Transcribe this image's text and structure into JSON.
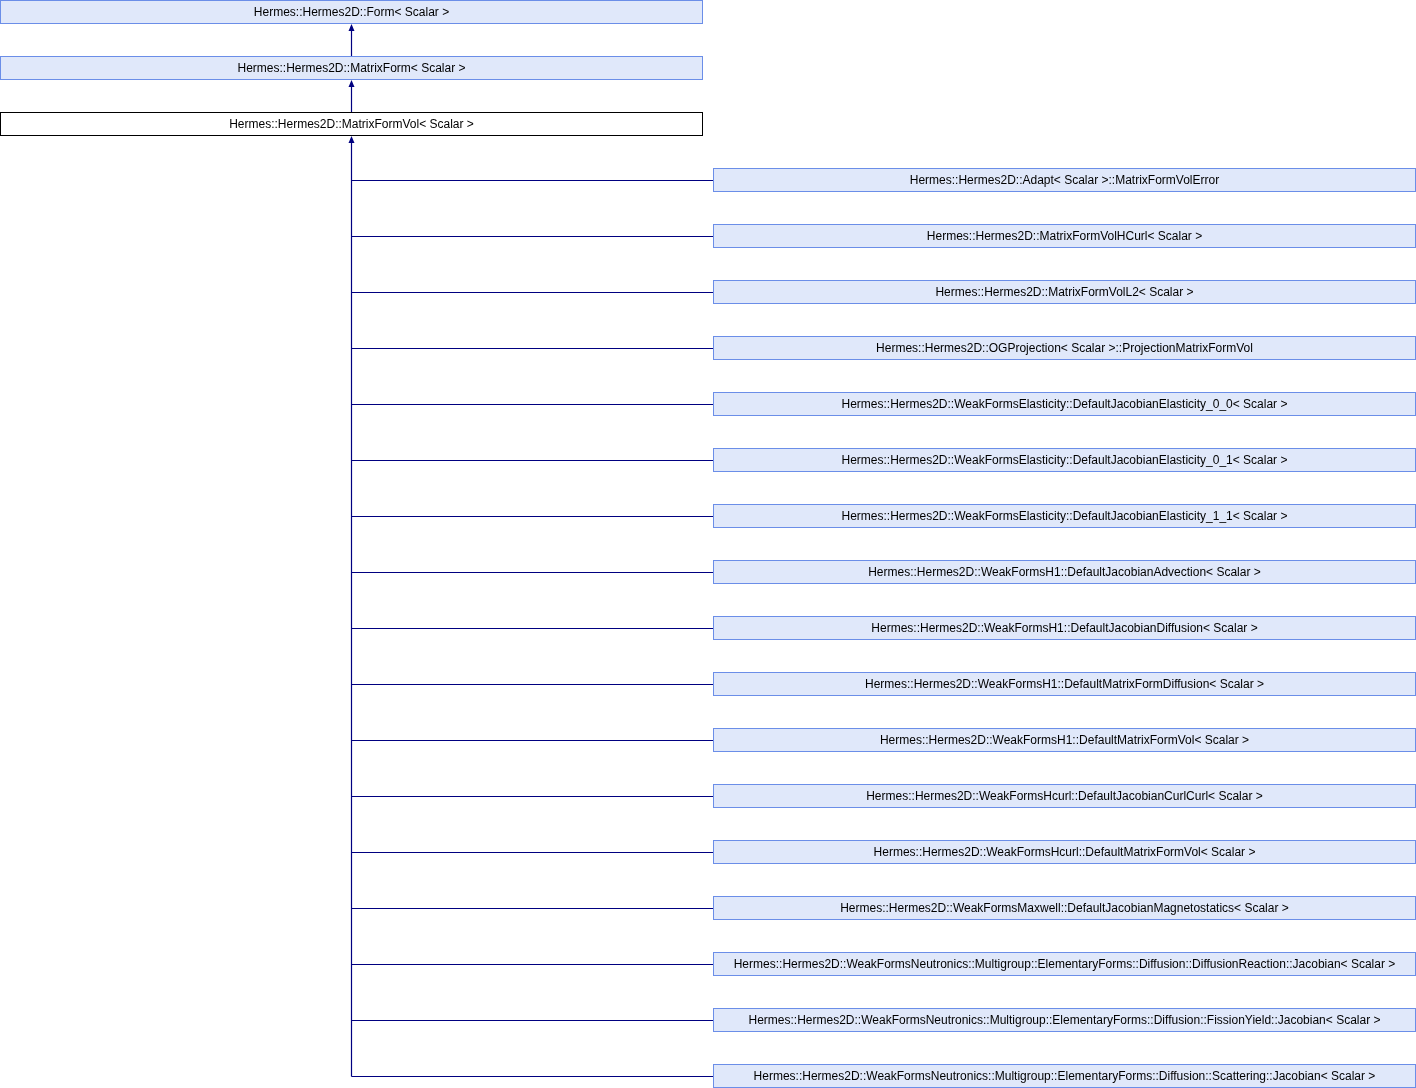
{
  "ancestors": [
    {
      "name": "Hermes::Hermes2D::Form< Scalar >",
      "kind": "base"
    },
    {
      "name": "Hermes::Hermes2D::MatrixForm< Scalar >",
      "kind": "base"
    },
    {
      "name": "Hermes::Hermes2D::MatrixFormVol< Scalar >",
      "kind": "current"
    }
  ],
  "derived": [
    {
      "name": "Hermes::Hermes2D::Adapt< Scalar >::MatrixFormVolError"
    },
    {
      "name": "Hermes::Hermes2D::MatrixFormVolHCurl< Scalar >"
    },
    {
      "name": "Hermes::Hermes2D::MatrixFormVolL2< Scalar >"
    },
    {
      "name": "Hermes::Hermes2D::OGProjection< Scalar >::ProjectionMatrixFormVol"
    },
    {
      "name": "Hermes::Hermes2D::WeakFormsElasticity::DefaultJacobianElasticity_0_0< Scalar >"
    },
    {
      "name": "Hermes::Hermes2D::WeakFormsElasticity::DefaultJacobianElasticity_0_1< Scalar >"
    },
    {
      "name": "Hermes::Hermes2D::WeakFormsElasticity::DefaultJacobianElasticity_1_1< Scalar >"
    },
    {
      "name": "Hermes::Hermes2D::WeakFormsH1::DefaultJacobianAdvection< Scalar >"
    },
    {
      "name": "Hermes::Hermes2D::WeakFormsH1::DefaultJacobianDiffusion< Scalar >"
    },
    {
      "name": "Hermes::Hermes2D::WeakFormsH1::DefaultMatrixFormDiffusion< Scalar >"
    },
    {
      "name": "Hermes::Hermes2D::WeakFormsH1::DefaultMatrixFormVol< Scalar >"
    },
    {
      "name": "Hermes::Hermes2D::WeakFormsHcurl::DefaultJacobianCurlCurl< Scalar >"
    },
    {
      "name": "Hermes::Hermes2D::WeakFormsHcurl::DefaultMatrixFormVol< Scalar >"
    },
    {
      "name": "Hermes::Hermes2D::WeakFormsMaxwell::DefaultJacobianMagnetostatics< Scalar >"
    },
    {
      "name": "Hermes::Hermes2D::WeakFormsNeutronics::Multigroup::ElementaryForms::Diffusion::DiffusionReaction::Jacobian< Scalar >"
    },
    {
      "name": "Hermes::Hermes2D::WeakFormsNeutronics::Multigroup::ElementaryForms::Diffusion::FissionYield::Jacobian< Scalar >"
    },
    {
      "name": "Hermes::Hermes2D::WeakFormsNeutronics::Multigroup::ElementaryForms::Diffusion::Scattering::Jacobian< Scalar >"
    }
  ]
}
